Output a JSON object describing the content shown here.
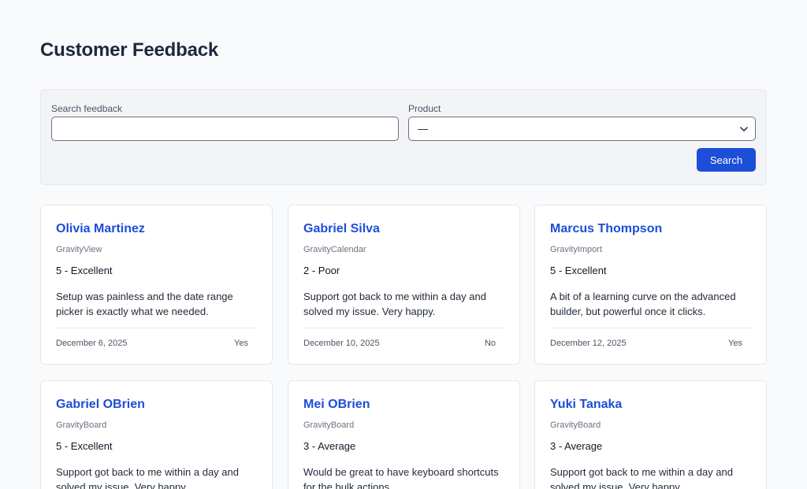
{
  "header": {
    "title": "Customer Feedback"
  },
  "filters": {
    "search_label": "Search feedback",
    "search_value": "",
    "product_label": "Product",
    "product_selected": "—",
    "search_button": "Search"
  },
  "cards": [
    {
      "name": "Olivia Martinez",
      "product": "GravityView",
      "rating": "5 - Excellent",
      "comment": "Setup was painless and the date range picker is exactly what we needed.",
      "date": "December 6, 2025",
      "flag": "Yes"
    },
    {
      "name": "Gabriel Silva",
      "product": "GravityCalendar",
      "rating": "2 - Poor",
      "comment": "Support got back to me within a day and solved my issue. Very happy.",
      "date": "December 10, 2025",
      "flag": "No"
    },
    {
      "name": "Marcus Thompson",
      "product": "GravityImport",
      "rating": "5 - Excellent",
      "comment": "A bit of a learning curve on the advanced builder, but powerful once it clicks.",
      "date": "December 12, 2025",
      "flag": "Yes"
    },
    {
      "name": "Gabriel OBrien",
      "product": "GravityBoard",
      "rating": "5 - Excellent",
      "comment": "Support got back to me within a day and solved my issue. Very happy."
    },
    {
      "name": "Mei OBrien",
      "product": "GravityBoard",
      "rating": "3 - Average",
      "comment": "Would be great to have keyboard shortcuts for the bulk actions."
    },
    {
      "name": "Yuki Tanaka",
      "product": "GravityBoard",
      "rating": "3 - Average",
      "comment": "Support got back to me within a day and solved my issue. Very happy."
    }
  ]
}
